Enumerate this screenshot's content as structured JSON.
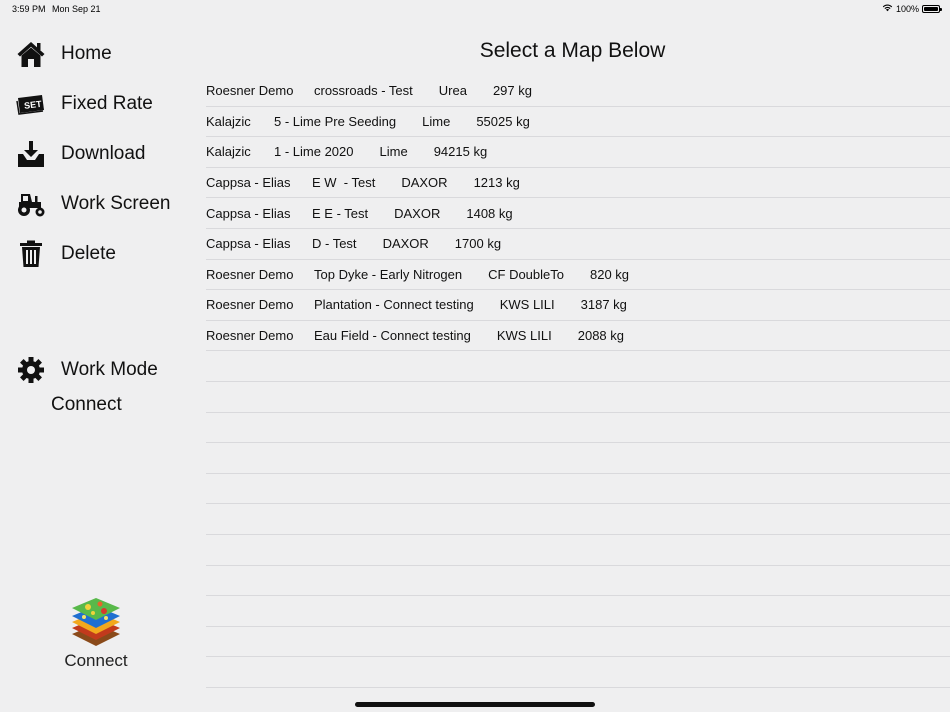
{
  "status_bar": {
    "time": "3:59 PM",
    "date": "Mon Sep 21",
    "battery": "100%",
    "wifi_icon": "wifi-icon",
    "battery_icon": "battery-icon"
  },
  "sidebar": {
    "items": [
      {
        "label": "Home",
        "icon": "home-icon"
      },
      {
        "label": "Fixed Rate",
        "icon": "set-tag-icon"
      },
      {
        "label": "Download",
        "icon": "download-tray-icon"
      },
      {
        "label": "Work Screen",
        "icon": "tractor-icon"
      },
      {
        "label": "Delete",
        "icon": "trash-icon"
      }
    ],
    "work_mode": {
      "label": "Work Mode",
      "icon": "gear-icon",
      "value": "Connect"
    },
    "logo_text": "Connect"
  },
  "main": {
    "title": "Select a Map Below",
    "maps": [
      {
        "farm": "Roesner Demo",
        "field": "crossroads - Test",
        "product": "Urea",
        "amount": "297 kg"
      },
      {
        "farm": "Kalajzic",
        "field": "5 - Lime Pre Seeding",
        "product": "Lime",
        "amount": "55025 kg"
      },
      {
        "farm": "Kalajzic",
        "field": "1 - Lime 2020",
        "product": "Lime",
        "amount": "94215 kg"
      },
      {
        "farm": "Cappsa - Elias",
        "field": "E W  - Test",
        "product": "DAXOR",
        "amount": "1213 kg"
      },
      {
        "farm": "Cappsa - Elias",
        "field": "E E - Test",
        "product": "DAXOR",
        "amount": "1408 kg"
      },
      {
        "farm": "Cappsa - Elias",
        "field": "D - Test",
        "product": "DAXOR",
        "amount": "1700 kg"
      },
      {
        "farm": "Roesner Demo",
        "field": "Top Dyke - Early Nitrogen",
        "product": "CF DoubleTo",
        "amount": "820 kg"
      },
      {
        "farm": "Roesner Demo",
        "field": "Plantation - Connect testing",
        "product": "KWS LILI",
        "amount": "3187 kg"
      },
      {
        "farm": "Roesner Demo",
        "field": "Eau Field - Connect testing",
        "product": "KWS LILI",
        "amount": "2088 kg"
      }
    ]
  }
}
